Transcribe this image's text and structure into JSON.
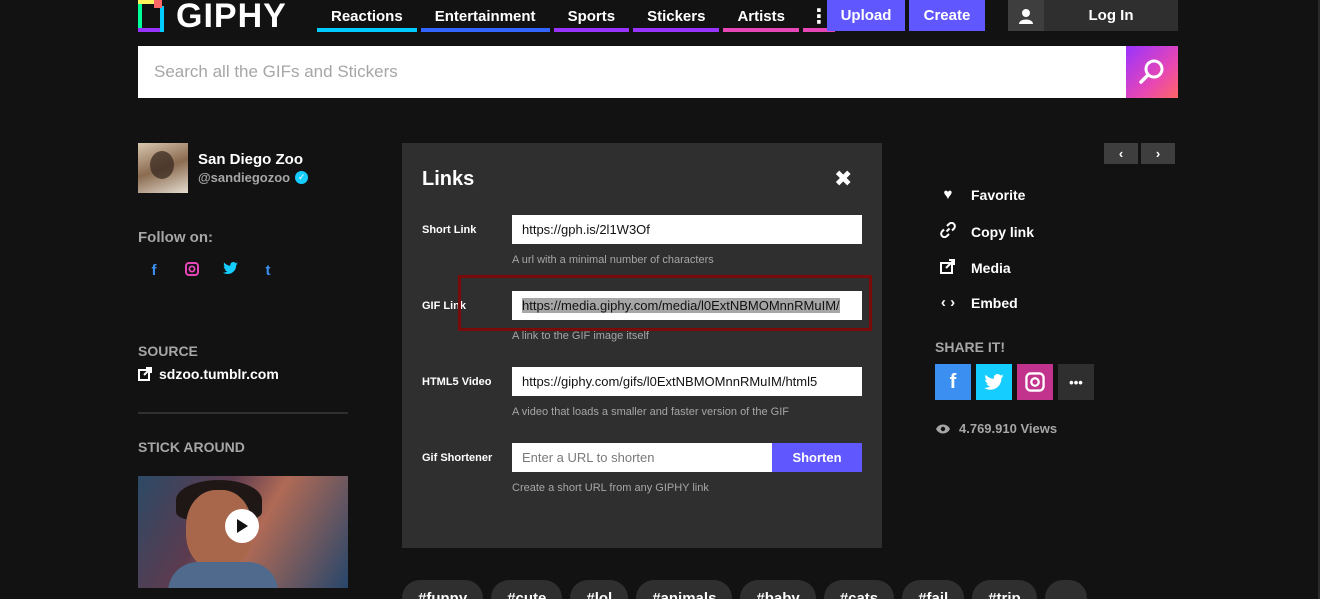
{
  "header": {
    "logo_text": "GIPHY",
    "nav": [
      {
        "label": "Reactions",
        "color": "#00ccff"
      },
      {
        "label": "Entertainment",
        "color": "#3366ff"
      },
      {
        "label": "Sports",
        "color": "#9933ff"
      },
      {
        "label": "Stickers",
        "color": "#9933ff"
      },
      {
        "label": "Artists",
        "color": "#e646b6"
      },
      {
        "label": "⋮",
        "color": "#e646b6"
      }
    ],
    "upload_label": "Upload",
    "create_label": "Create",
    "login_label": "Log In"
  },
  "search": {
    "placeholder": "Search all the GIFs and Stickers"
  },
  "user": {
    "name": "San Diego Zoo",
    "handle": "@sandiegozoo",
    "verified_icon": "✓",
    "follow_label": "Follow on:",
    "follow_icons": [
      "f",
      "◎",
      "🐦",
      "t"
    ]
  },
  "source": {
    "label": "SOURCE",
    "link": "sdzoo.tumblr.com"
  },
  "stick_around_label": "STICK AROUND",
  "links_panel": {
    "title": "Links",
    "close_icon": "✖",
    "short_link": {
      "label": "Short Link",
      "value": "https://gph.is/2l1W3Of",
      "hint": "A url with a minimal number of characters"
    },
    "gif_link": {
      "label": "GIF Link",
      "value": "https://media.giphy.com/media/l0ExtNBMOMnnRMuIM/",
      "hint": "A link to the GIF image itself"
    },
    "html5_video": {
      "label": "HTML5 Video",
      "value": "https://giphy.com/gifs/l0ExtNBMOMnnRMuIM/html5",
      "hint": "A video that loads a smaller and faster version of the GIF"
    },
    "gif_shortener": {
      "label": "Gif Shortener",
      "placeholder": "Enter a URL to shorten",
      "button": "Shorten",
      "hint": "Create a short URL from any GIPHY link"
    }
  },
  "pager": {
    "prev": "‹",
    "next": "›"
  },
  "actions": [
    {
      "icon": "♥",
      "label": "Favorite"
    },
    {
      "icon": "🔗",
      "label": "Copy link"
    },
    {
      "icon": "↗",
      "label": "Media"
    },
    {
      "icon": "‹ ›",
      "label": "Embed"
    }
  ],
  "share": {
    "label": "SHARE IT!",
    "buttons": [
      {
        "icon": "f",
        "color": "#3b8ff0"
      },
      {
        "icon": "t",
        "color": "#15cdff"
      },
      {
        "icon": "◎",
        "color": "#c2338d"
      },
      {
        "icon": "•••",
        "color": "#2f2f2f"
      }
    ]
  },
  "views": "4.769.910 Views",
  "tags": [
    "#funny",
    "#cute",
    "#lol",
    "#animals",
    "#baby",
    "#cats",
    "#fail",
    "#trip",
    ""
  ]
}
